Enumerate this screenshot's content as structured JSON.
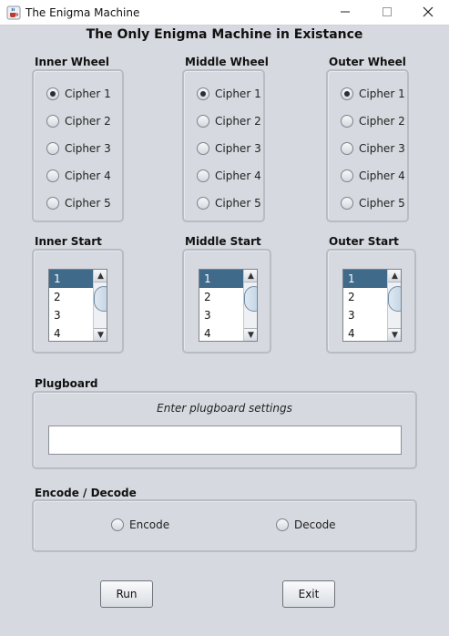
{
  "window": {
    "title": "The Enigma Machine"
  },
  "heading": "The Only Enigma Machine in Existance",
  "wheels": [
    {
      "label": "Inner Wheel",
      "options": [
        "Cipher 1",
        "Cipher 2",
        "Cipher 3",
        "Cipher 4",
        "Cipher 5"
      ],
      "selected": "Cipher 1"
    },
    {
      "label": "Middle Wheel",
      "options": [
        "Cipher 1",
        "Cipher 2",
        "Cipher 3",
        "Cipher 4",
        "Cipher 5"
      ],
      "selected": "Cipher 1"
    },
    {
      "label": "Outer Wheel",
      "options": [
        "Cipher 1",
        "Cipher 2",
        "Cipher 3",
        "Cipher 4",
        "Cipher 5"
      ],
      "selected": "Cipher 1"
    }
  ],
  "starts": [
    {
      "label": "Inner Start",
      "items": [
        "1",
        "2",
        "3",
        "4"
      ],
      "selected": "1"
    },
    {
      "label": "Middle Start",
      "items": [
        "1",
        "2",
        "3",
        "4"
      ],
      "selected": "1"
    },
    {
      "label": "Outer Start",
      "items": [
        "1",
        "2",
        "3",
        "4"
      ],
      "selected": "1"
    }
  ],
  "plugboard": {
    "label": "Plugboard",
    "prompt": "Enter plugboard settings",
    "value": ""
  },
  "mode": {
    "label": "Encode / Decode",
    "options": [
      "Encode",
      "Decode"
    ],
    "selected": null
  },
  "buttons": {
    "run": "Run",
    "exit": "Exit"
  },
  "icons": {
    "app": "java-coffee-cup-icon",
    "minimize": "minimize-icon",
    "maximize": "maximize-icon",
    "close": "close-icon",
    "scroll_up": "scroll-up-arrow-icon",
    "scroll_down": "scroll-down-arrow-icon"
  },
  "colors": {
    "background": "#d6d9df",
    "selection": "#3f6a8a",
    "panel_border": "#b8bcc3"
  }
}
